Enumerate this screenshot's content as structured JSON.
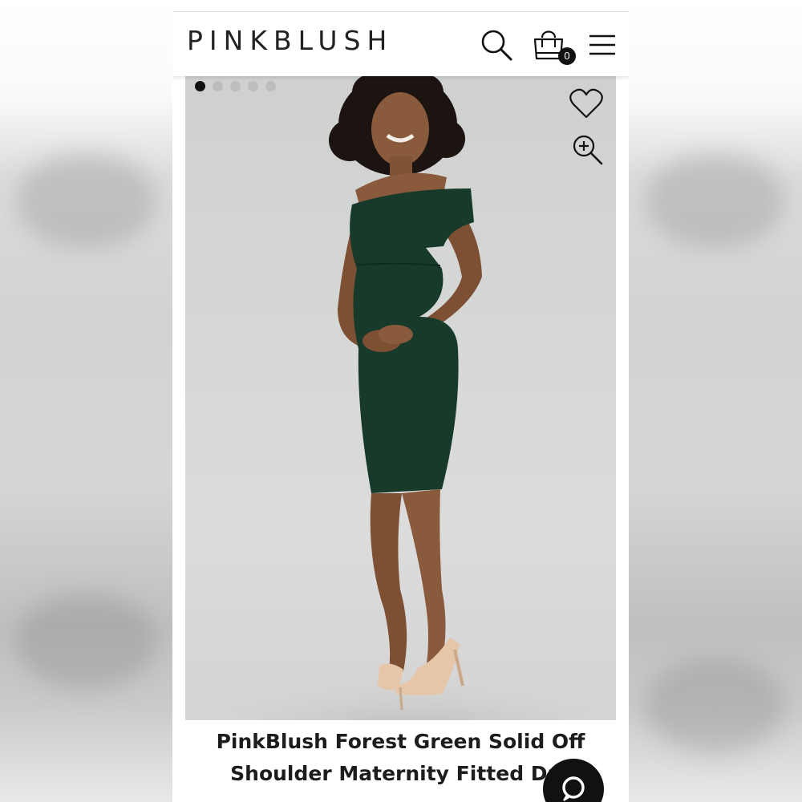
{
  "header": {
    "logo": "PINKBLUSH",
    "cart_count": "0"
  },
  "icons": {
    "search": "search-icon",
    "bag": "shopping-bag-icon",
    "menu": "hamburger-menu-icon",
    "favorite": "heart-icon",
    "zoom": "zoom-in-icon",
    "chat": "chat-icon"
  },
  "carousel": {
    "count": 5,
    "active_index": 0
  },
  "product": {
    "title_line1": "PinkBlush Forest Green Solid Off",
    "title_line2": "Shoulder Maternity Fitted Dre"
  },
  "colors": {
    "dress": "#173a2a",
    "background": "#d5d5d5",
    "accent": "#111111"
  }
}
